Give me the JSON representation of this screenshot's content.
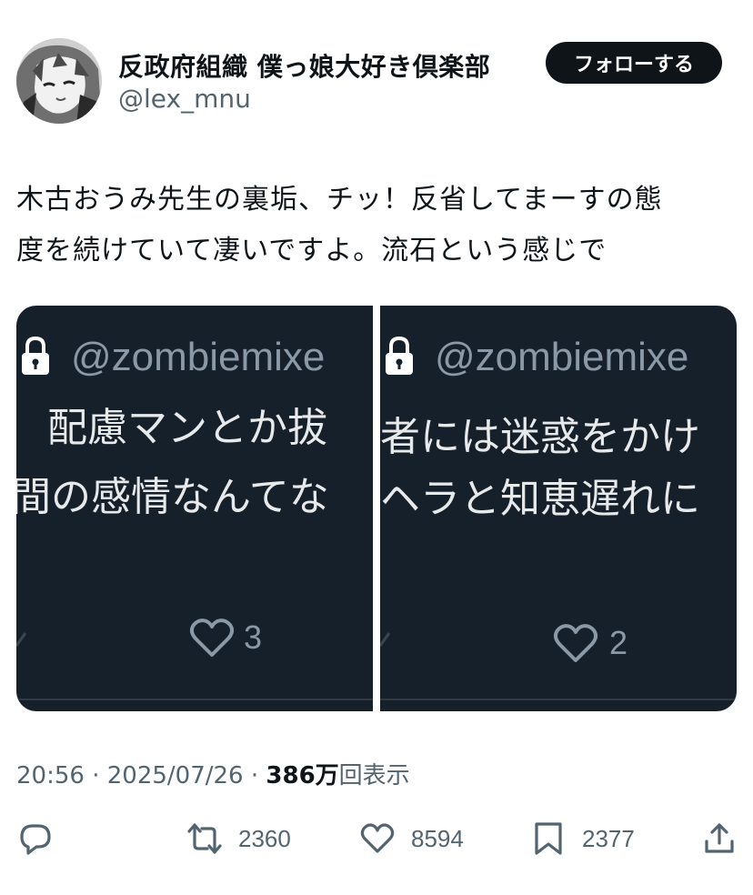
{
  "author": {
    "display_name": "反政府組織 僕っ娘大好き倶楽部",
    "handle": "@lex_mnu",
    "avatar_icon": "anime-avatar-icon"
  },
  "follow_label": "フォローする",
  "tweet_text_line1": "木古おうみ先生の裏垢、チッ！反省してまーすの態",
  "tweet_text_line2": "度を続けていて凄いですよ。流石という感じで",
  "media": {
    "left": {
      "handle": "@zombiemixe",
      "line1": "配慮マンとか拔",
      "line2": "間の感情なんてな",
      "likes": "3"
    },
    "right": {
      "handle": "@zombiemixe",
      "line1": "者には迷惑をかけ",
      "line2": "ヘラと知恵遅れに",
      "likes": "2"
    }
  },
  "meta": {
    "time": "20:56",
    "separator": "·",
    "date": "2025/07/26",
    "views_count": "386万",
    "views_label": "回表示"
  },
  "actions": {
    "reply_icon": "reply-icon",
    "retweet_count": "2360",
    "like_count": "8594",
    "bookmark_count": "2377",
    "share_icon": "share-icon"
  },
  "colors": {
    "panel_bg": "#15202b",
    "follow_bg": "#0f1419",
    "secondary_text": "#536471"
  }
}
